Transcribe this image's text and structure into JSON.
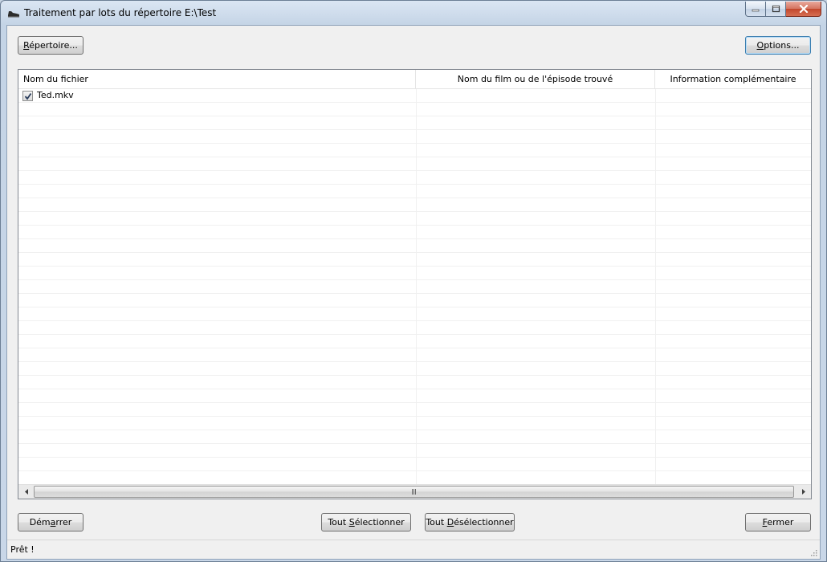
{
  "window": {
    "title": "Traitement par lots du répertoire E:\\Test"
  },
  "toolbar": {
    "directory_button": {
      "underlined": "R",
      "rest": "épertoire..."
    },
    "options_button": {
      "underlined": "O",
      "rest": "ptions..."
    }
  },
  "listview": {
    "columns": [
      {
        "label": "Nom du fichier"
      },
      {
        "label": "Nom du film ou de l'épisode trouvé"
      },
      {
        "label": "Information complémentaire"
      }
    ],
    "rows": [
      {
        "checked": true,
        "file": "Ted.mkv",
        "title": "",
        "info": ""
      }
    ]
  },
  "bottom_buttons": {
    "start": {
      "pre": "Dém",
      "underlined": "a",
      "post": "rrer"
    },
    "select_all": {
      "pre": "Tout ",
      "underlined": "S",
      "post": "électionner"
    },
    "deselect_all": {
      "pre": "Tout ",
      "underlined": "D",
      "post": "ésélectionner"
    },
    "close": {
      "pre": "",
      "underlined": "F",
      "post": "ermer"
    }
  },
  "status": {
    "text": "Prêt !"
  },
  "colors": {
    "accent": "#3c7fb1",
    "close_button": "#c2472d"
  }
}
